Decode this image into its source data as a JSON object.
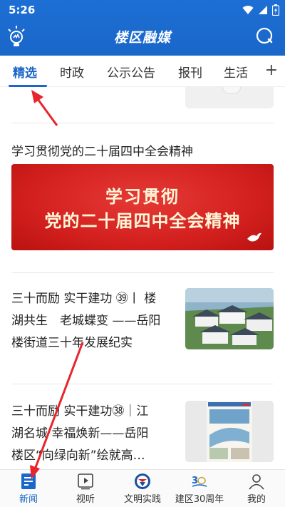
{
  "status_bar": {
    "time": "5:26"
  },
  "app": {
    "title": "楼区融媒"
  },
  "tabs": [
    {
      "label": "精选",
      "active": true
    },
    {
      "label": "时政",
      "active": false
    },
    {
      "label": "公示公告",
      "active": false
    },
    {
      "label": "报刊",
      "active": false
    },
    {
      "label": "生活",
      "active": false
    }
  ],
  "tab_add_label": "+",
  "topic": {
    "title": "学习贯彻党的二十届四中全会精神",
    "banner_line1": "学习贯彻",
    "banner_line2": "党的二十届四中全会精神"
  },
  "news": [
    {
      "line1": "三十而励 实干建功 ㊴丨 楼",
      "line2": "湖共生　老城蝶变 ——岳阳",
      "line3": "楼街道三十年发展纪实"
    },
    {
      "line1": "三十而励 实干建功㊳｜江",
      "line2": "湖名城 幸福焕新——岳阳",
      "line3": "楼区“向绿向新”绘就高…"
    }
  ],
  "bottom_nav": [
    {
      "label": "新闻",
      "icon": "news-icon",
      "active": true
    },
    {
      "label": "视听",
      "icon": "video-icon",
      "active": false
    },
    {
      "label": "文明实践",
      "icon": "civilization-practice-icon",
      "active": false
    },
    {
      "label": "建区30周年",
      "icon": "anniversary-30-icon",
      "active": false
    },
    {
      "label": "我的",
      "icon": "profile-icon",
      "active": false
    }
  ],
  "colors": {
    "brand": "#1a66c9",
    "banner_red": "#d3201f",
    "annotation_arrow": "#e8242c"
  }
}
